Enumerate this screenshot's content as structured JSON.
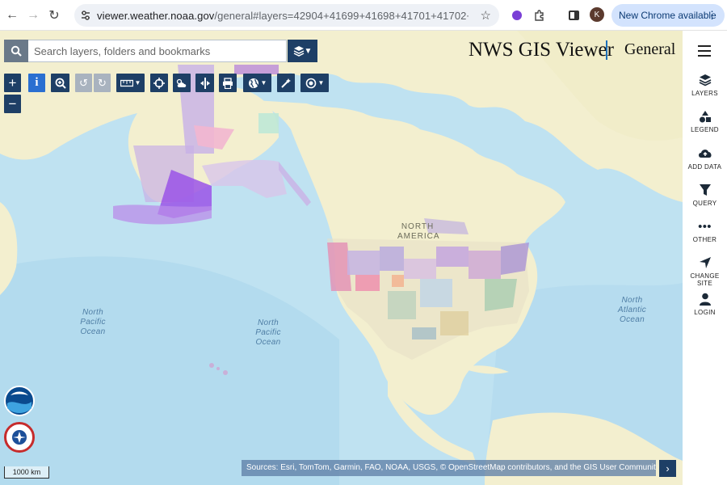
{
  "browser": {
    "url_domain": "viewer.weather.noaa.gov",
    "url_path": "/general#layers=42904+41699+41698+41701+41702+41703+...",
    "update_label": "New Chrome available",
    "avatar_letter": "K"
  },
  "app": {
    "title": "NWS GIS Viewer",
    "subtitle": "General"
  },
  "search": {
    "placeholder": "Search layers, folders and bookmarks"
  },
  "sidebar": {
    "items": [
      {
        "label": "LAYERS",
        "icon": "layers-icon"
      },
      {
        "label": "LEGEND",
        "icon": "legend-icon"
      },
      {
        "label": "ADD DATA",
        "icon": "cloud-upload-icon"
      },
      {
        "label": "QUERY",
        "icon": "filter-icon"
      },
      {
        "label": "OTHER",
        "icon": "more-icon"
      },
      {
        "label": "CHANGE SITE",
        "icon": "location-arrow-icon"
      },
      {
        "label": "LOGIN",
        "icon": "user-icon"
      }
    ]
  },
  "map": {
    "labels": {
      "north_america": "NORTH\nAMERICA",
      "north_pacific_left": "North\nPacific\nOcean",
      "north_pacific_center": "North\nPacific\nOcean",
      "north_atlantic": "North\nAtlantic\nOcean"
    },
    "scale": "1000 km",
    "attribution": "Sources: Esri, TomTom, Garmin, FAO, NOAA, USGS, © OpenStreetMap contributors, and the GIS User Community"
  },
  "colors": {
    "ocean": "#bfe2f1",
    "land": "#f3efcf",
    "toolbar": "#1e3f66"
  }
}
